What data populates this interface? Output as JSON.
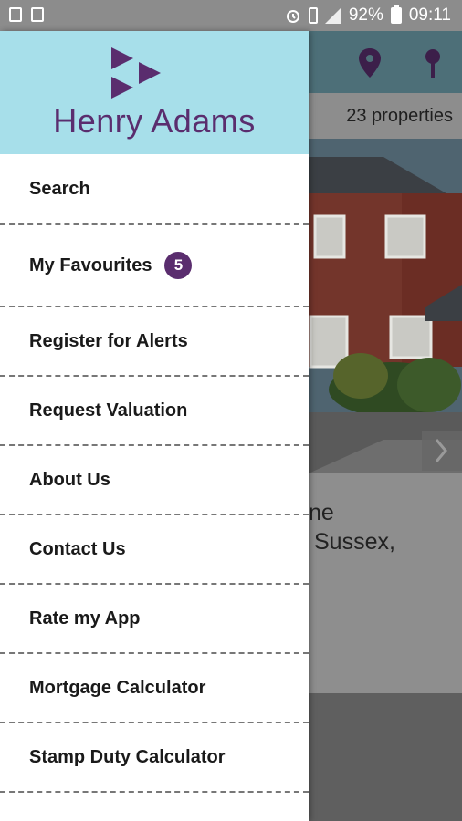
{
  "status_bar": {
    "battery": "92%",
    "time": "09:11"
  },
  "background": {
    "property_count": "23 properties",
    "snippet_line1": "ne",
    "snippet_line2": "Sussex,"
  },
  "drawer": {
    "brand": "Henry Adams",
    "brand_color": "#5a2d6e",
    "header_color": "#a7dfea",
    "items": [
      {
        "label": "Search"
      },
      {
        "label": "My Favourites",
        "badge": "5"
      },
      {
        "label": "Register for Alerts"
      },
      {
        "label": "Request Valuation"
      },
      {
        "label": "About Us"
      },
      {
        "label": "Contact Us"
      },
      {
        "label": "Rate my App"
      },
      {
        "label": "Mortgage Calculator"
      },
      {
        "label": "Stamp Duty Calculator"
      }
    ]
  }
}
